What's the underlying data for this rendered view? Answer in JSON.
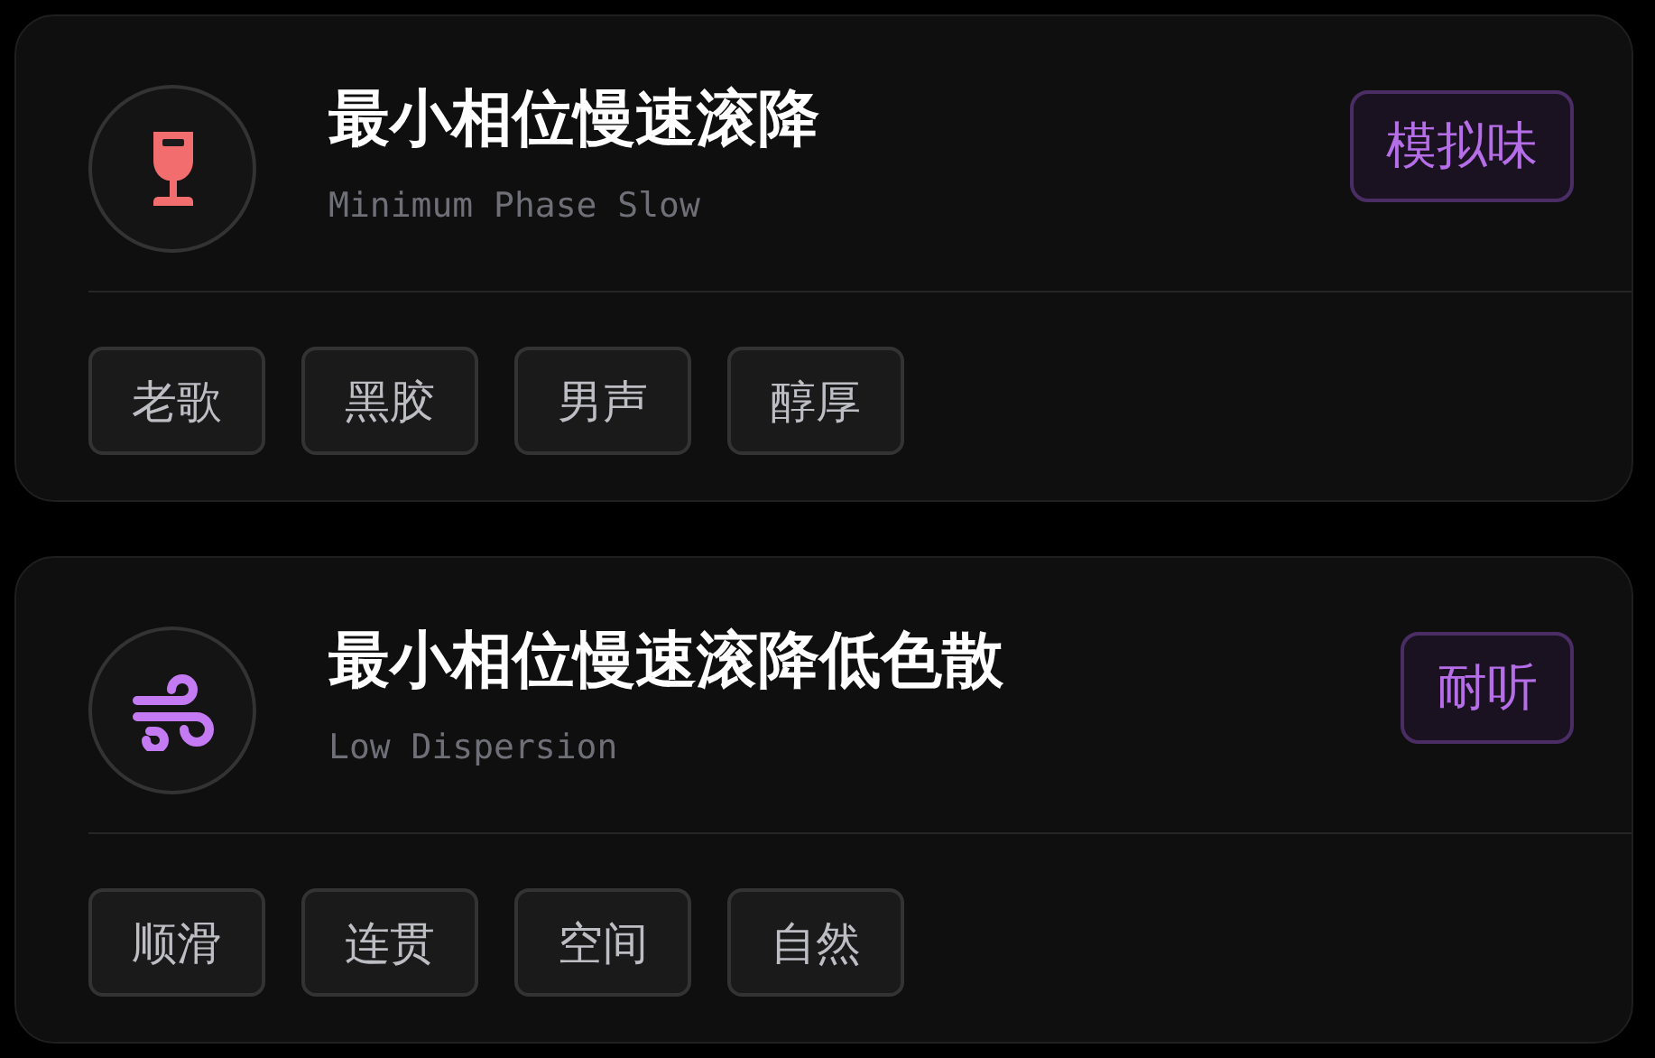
{
  "cards": [
    {
      "icon": {
        "kind": "wine-glass",
        "color": "#f26d6d"
      },
      "title": "最小相位慢速滚降",
      "subtitle": "Minimum Phase Slow",
      "badge": "模拟味",
      "tags": [
        "老歌",
        "黑胶",
        "男声",
        "醇厚"
      ]
    },
    {
      "icon": {
        "kind": "wind",
        "color": "#c47af2"
      },
      "title": "最小相位慢速滚降低色散",
      "subtitle": "Low Dispersion",
      "badge": "耐听",
      "tags": [
        "顺滑",
        "连贯",
        "空间",
        "自然"
      ]
    }
  ]
}
